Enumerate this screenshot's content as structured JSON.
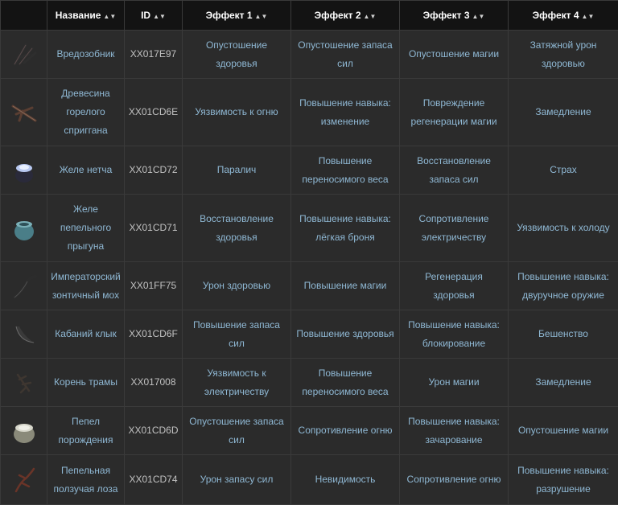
{
  "table": {
    "headers": [
      "",
      "Название",
      "ID",
      "Эффект 1",
      "Эффект 2",
      "Эффект 3",
      "Эффект 4"
    ],
    "rows": [
      {
        "icon": "dark-twigs-icon",
        "name": "Вредозобник",
        "id": "XX017E97",
        "e1": "Опустошение здоровья",
        "e2": "Опустошение запаса сил",
        "e3": "Опустошение магии",
        "e4": "Затяжной урон здоровью"
      },
      {
        "icon": "charred-wood-icon",
        "name": "Древесина горелого сприггана",
        "id": "XX01CD6E",
        "e1": "Уязвимость к огню",
        "e2": "Повышение навыка: изменение",
        "e3": "Повреждение регенерации магии",
        "e4": "Замедление"
      },
      {
        "icon": "netch-jelly-icon",
        "name": "Желе нетча",
        "id": "XX01CD72",
        "e1": "Паралич",
        "e2": "Повышение переносимого веса",
        "e3": "Восстановление запаса сил",
        "e4": "Страх"
      },
      {
        "icon": "ash-hopper-jelly-icon",
        "name": "Желе пепельного прыгуна",
        "id": "XX01CD71",
        "e1": "Восстановление здоровья",
        "e2": "Повышение навыка: лёгкая броня",
        "e3": "Сопротивление электричеству",
        "e4": "Уязвимость к холоду"
      },
      {
        "icon": "parasol-moss-icon",
        "name": "Императорский зонтичный мох",
        "id": "XX01FF75",
        "e1": "Урон здоровью",
        "e2": "Повышение магии",
        "e3": "Регенерация здоровья",
        "e4": "Повышение навыка: двуручное оружие"
      },
      {
        "icon": "boar-tusk-icon",
        "name": "Кабаний клык",
        "id": "XX01CD6F",
        "e1": "Повышение запаса сил",
        "e2": "Повышение здоровья",
        "e3": "Повышение навыка: блокирование",
        "e4": "Бешенство"
      },
      {
        "icon": "trama-root-icon",
        "name": "Корень трамы",
        "id": "XX017008",
        "e1": "Уязвимость к электричеству",
        "e2": "Повышение переносимого веса",
        "e3": "Урон магии",
        "e4": "Замедление"
      },
      {
        "icon": "spawn-ash-icon",
        "name": "Пепел порождения",
        "id": "XX01CD6D",
        "e1": "Опустошение запаса сил",
        "e2": "Сопротивление огню",
        "e3": "Повышение навыка: зачарование",
        "e4": "Опустошение магии"
      },
      {
        "icon": "ashen-creep-vine-icon",
        "name": "Пепельная ползучая лоза",
        "id": "XX01CD74",
        "e1": "Урон запасу сил",
        "e2": "Невидимость",
        "e3": "Сопротивление огню",
        "e4": "Повышение навыка: разрушение"
      }
    ]
  }
}
